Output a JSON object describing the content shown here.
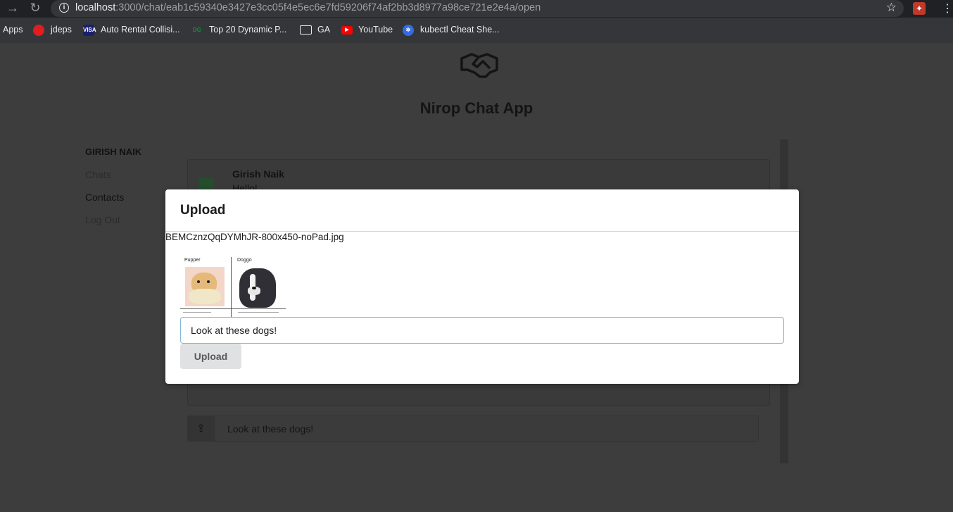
{
  "browser": {
    "url_host": "localhost",
    "url_path": ":3000/chat/eab1c59340e3427e3cc05f4e5ec6e7fd59206f74af2bb3d8977a98ce721e2e4a/open",
    "back_icon": "arrow-right-icon",
    "reload_icon": "reload-icon"
  },
  "bookmarks": [
    {
      "label": "Apps"
    },
    {
      "label": "jdeps",
      "icon": "oracle-icon",
      "color": "#e01e1e"
    },
    {
      "label": "Auto Rental Collisi...",
      "icon": "visa-icon",
      "color": "#1a1f71"
    },
    {
      "label": "Top 20 Dynamic P...",
      "icon": "dg-icon",
      "color": "#1e8a3c"
    },
    {
      "label": "GA",
      "icon": "folder-icon"
    },
    {
      "label": "YouTube",
      "icon": "youtube-icon",
      "color": "#ff0000"
    },
    {
      "label": "kubectl Cheat She...",
      "icon": "kubernetes-icon",
      "color": "#326ce5"
    }
  ],
  "app": {
    "title": "Nirop Chat App",
    "user_name": "GIRISH NAIK",
    "nav": [
      "Chats",
      "Contacts",
      "Log Out"
    ],
    "chat": {
      "sender": "Girish Naik",
      "message": "Hello!"
    },
    "input_value": "Look at these dogs!"
  },
  "modal": {
    "title": "Upload",
    "file_name": "BEMCznzQqDYMhJR-800x450-noPad.jpg",
    "preview_labels": [
      "Pupper",
      "Doggo"
    ],
    "message_value": "Look at these dogs!",
    "upload_label": "Upload"
  },
  "colors": {
    "modal_bg": "#ffffff",
    "input_focus_border": "#85b7d9",
    "button_bg": "#e0e1e2"
  }
}
